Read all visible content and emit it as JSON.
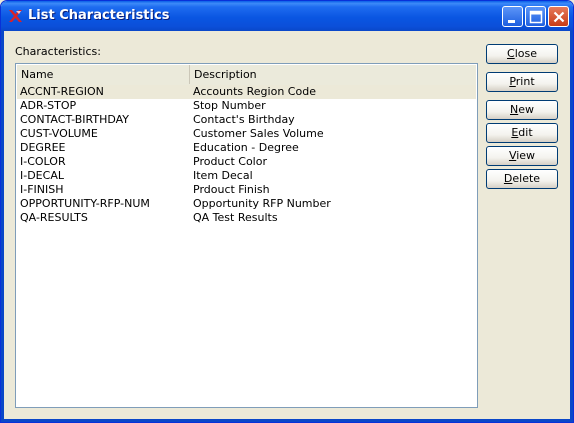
{
  "window": {
    "title": "List Characteristics"
  },
  "main": {
    "label": "Characteristics:",
    "columns": [
      "Name",
      "Description"
    ],
    "rows": [
      {
        "name": "ACCNT-REGION",
        "description": "Accounts Region Code"
      },
      {
        "name": "ADR-STOP",
        "description": "Stop Number"
      },
      {
        "name": "CONTACT-BIRTHDAY",
        "description": "Contact's Birthday"
      },
      {
        "name": "CUST-VOLUME",
        "description": "Customer Sales Volume"
      },
      {
        "name": "DEGREE",
        "description": "Education - Degree"
      },
      {
        "name": "I-COLOR",
        "description": "Product Color"
      },
      {
        "name": "I-DECAL",
        "description": "Item Decal"
      },
      {
        "name": "I-FINISH",
        "description": "Prdouct Finish"
      },
      {
        "name": "OPPORTUNITY-RFP-NUM",
        "description": "Opportunity RFP Number"
      },
      {
        "name": "QA-RESULTS",
        "description": "QA Test Results"
      }
    ]
  },
  "buttons": {
    "close": {
      "mnemonic": "C",
      "rest": "lose"
    },
    "print": {
      "mnemonic": "P",
      "rest": "rint"
    },
    "new": {
      "mnemonic": "N",
      "rest": "ew"
    },
    "edit": {
      "mnemonic": "E",
      "rest": "dit"
    },
    "view": {
      "mnemonic": "V",
      "rest": "iew"
    },
    "delete": {
      "mnemonic": "D",
      "rest": "elete"
    }
  },
  "colors": {
    "titlebar": "#0A56E2",
    "selection": "#ECE9D8",
    "close_button": "#C83B16"
  }
}
